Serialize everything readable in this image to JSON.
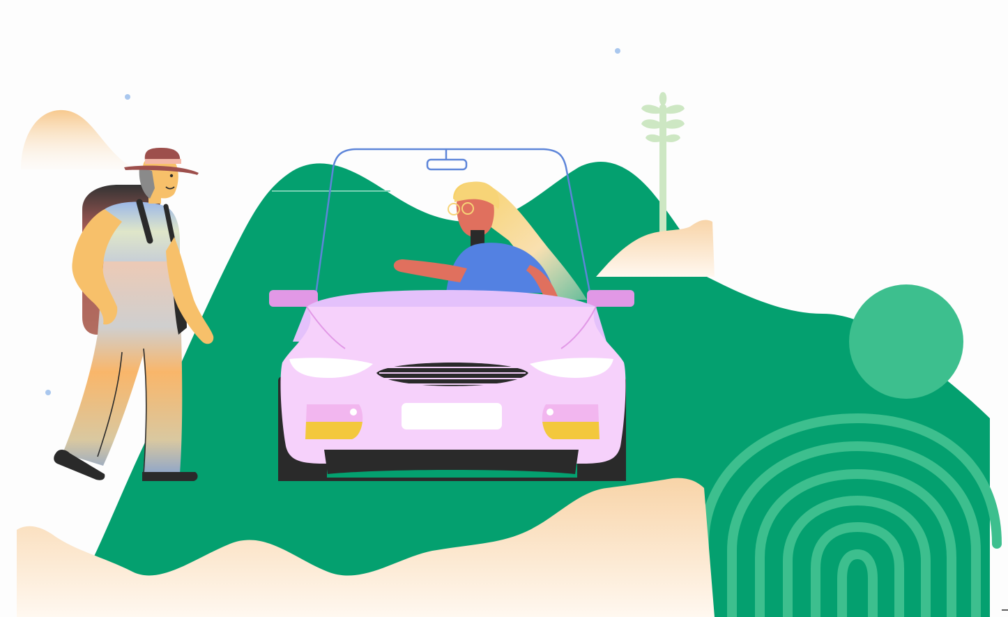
{
  "scene": {
    "description_tags": [
      "hitchhiker-illustration"
    ],
    "colors": {
      "background": "#fdfdfd",
      "hill_green": "#04a06f",
      "light_green": "#3dbf8e",
      "peach": "#f9d2a5",
      "car_body": "#f6d1fb",
      "car_bumper_purple": "#e198e6",
      "windshield_line": "#5d85d9",
      "shirt_blue": "#5381e2",
      "hair_yellow": "#f7d477",
      "skin_red": "#e0705e",
      "hat_brown": "#9d4f4c",
      "tree_pale": "#cde7c3",
      "dark": "#2a2a2a",
      "dot_blue": "#a9c7ee"
    },
    "icons": [
      "hitchhiker-figure",
      "car-illustration",
      "driver-figure",
      "tree-icon",
      "fingerprint-pattern"
    ]
  }
}
